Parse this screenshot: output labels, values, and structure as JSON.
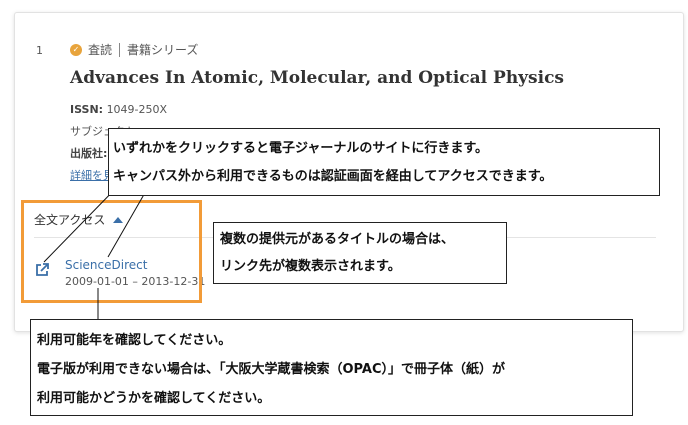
{
  "result": {
    "index": "1",
    "peer_reviewed": "査読",
    "type": "書籍シリーズ",
    "title": "Advances In Atomic, Molecular, and Optical Physics",
    "issn_label": "ISSN:",
    "issn_value": "1049-250X",
    "subject_label": "サブジェクト",
    "publisher_label": "出版社:",
    "details_link": "詳細を見る"
  },
  "full_access": {
    "label": "全文アクセス",
    "provider": "ScienceDirect",
    "dates": "2009-01-01 – 2013-12-31"
  },
  "callouts": {
    "c1_line1": "いずれかをクリックすると電子ジャーナルのサイトに行きます。",
    "c1_line2": "キャンパス外から利用できるものは認証画面を経由してアクセスできます。",
    "c2_line1": "複数の提供元があるタイトルの場合は、",
    "c2_line2": "リンク先が複数表示されます。",
    "c3_line1": "利用可能年を確認してください。",
    "c3_line2": "電子版が利用できない場合は、「大阪大学蔵書検索（OPAC）」で冊子体（紙）が",
    "c3_line3": "利用可能かどうかを確認してください。"
  },
  "colors": {
    "accent_link": "#3a6fa8",
    "highlight_border": "#f29b38",
    "badge": "#e8a43c"
  },
  "icons": {
    "peer_review": "check-badge-icon",
    "external_link": "external-link-icon",
    "expand": "caret-up-icon"
  }
}
